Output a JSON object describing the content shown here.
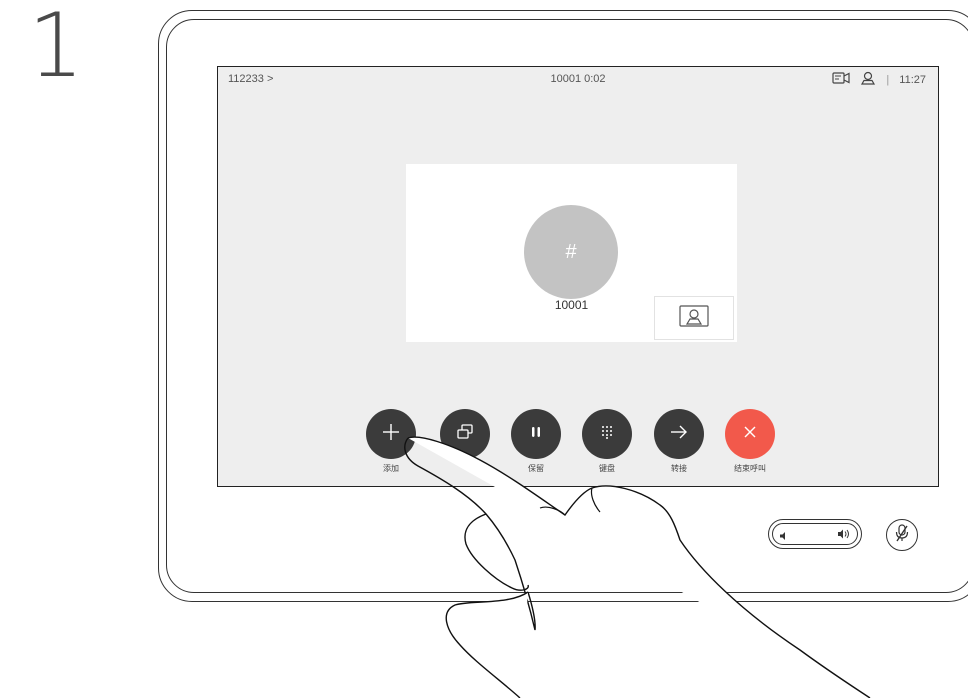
{
  "step_number": "1",
  "status_bar": {
    "call_id": "112233 >",
    "call_info": "10001  0:02",
    "time": "11:27",
    "separator": "|"
  },
  "call_card": {
    "avatar_symbol": "#",
    "callee": "10001"
  },
  "controls": [
    {
      "label": "添加",
      "icon": "plus-icon"
    },
    {
      "label": "",
      "icon": "share-icon"
    },
    {
      "label": "保留",
      "icon": "pause-icon"
    },
    {
      "label": "键盘",
      "icon": "keypad-icon"
    },
    {
      "label": "转接",
      "icon": "arrow-right-icon"
    },
    {
      "label": "结束呼叫",
      "icon": "close-icon"
    }
  ],
  "colors": {
    "button_dark": "#3b3b3b",
    "end_call_red": "#f2594b",
    "screen_bg": "#eeeeee",
    "avatar_gray": "#c3c3c3"
  }
}
